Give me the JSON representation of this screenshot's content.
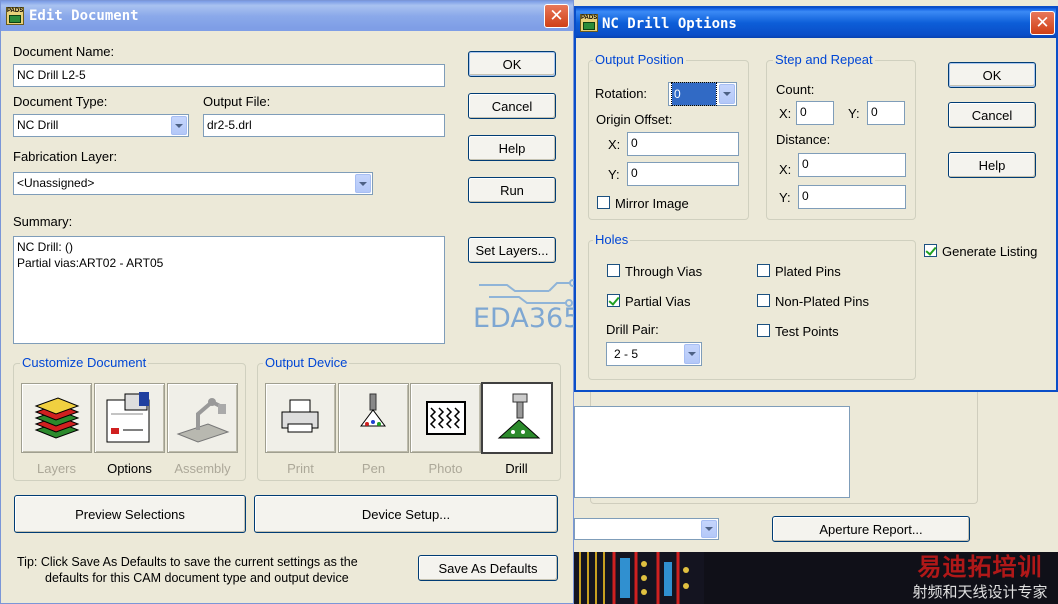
{
  "edit_document": {
    "title": "Edit Document",
    "doc_name_label": "Document Name:",
    "doc_name_value": "NC Drill L2-5",
    "doc_type_label": "Document Type:",
    "doc_type_value": "NC Drill",
    "output_file_label": "Output File:",
    "output_file_value": "dr2-5.drl",
    "fab_layer_label": "Fabrication Layer:",
    "fab_layer_value": "<Unassigned>",
    "summary_label": "Summary:",
    "summary_lines": [
      "NC Drill: ()",
      "Partial vias:ART02 - ART05"
    ],
    "buttons": {
      "ok": "OK",
      "cancel": "Cancel",
      "help": "Help",
      "run": "Run",
      "set_layers": "Set Layers...",
      "preview": "Preview Selections",
      "device_setup": "Device Setup...",
      "save_defaults": "Save As Defaults"
    },
    "customize_title": "Customize Document",
    "customize_items": [
      "Layers",
      "Options",
      "Assembly"
    ],
    "output_device_title": "Output Device",
    "device_items": [
      "Print",
      "Pen",
      "Photo",
      "Drill"
    ],
    "tip_line1": "Tip:  Click Save As Defaults to save the current settings as the",
    "tip_line2": "defaults for this CAM document type and output device",
    "watermark": "EDA365"
  },
  "nc_drill": {
    "title": "NC Drill Options",
    "output_position_title": "Output Position",
    "rotation_label": "Rotation:",
    "rotation_value": "0",
    "origin_offset_label": "Origin Offset:",
    "x_label": "X:",
    "y_label": "Y:",
    "origin_x": "0",
    "origin_y": "0",
    "mirror_label": "Mirror Image",
    "mirror_checked": false,
    "step_repeat_title": "Step and Repeat",
    "count_label": "Count:",
    "count_x": "0",
    "count_y": "0",
    "distance_label": "Distance:",
    "dist_x": "0",
    "dist_y": "0",
    "buttons": {
      "ok": "OK",
      "cancel": "Cancel",
      "help": "Help"
    },
    "generate_listing": "Generate Listing",
    "generate_listing_checked": true,
    "holes_title": "Holes",
    "through_vias": "Through Vias",
    "partial_vias": "Partial Vias",
    "plated_pins": "Plated Pins",
    "non_plated_pins": "Non-Plated Pins",
    "test_points": "Test Points",
    "through_vias_checked": false,
    "partial_vias_checked": true,
    "plated_pins_checked": false,
    "non_plated_pins_checked": false,
    "test_points_checked": false,
    "drill_pair_label": "Drill Pair:",
    "drill_pair_value": "2 - 5"
  },
  "background": {
    "aperture_report": "Aperture Report...",
    "watermark_line1": "易迪拓培训",
    "watermark_line2": "射频和天线设计专家"
  }
}
